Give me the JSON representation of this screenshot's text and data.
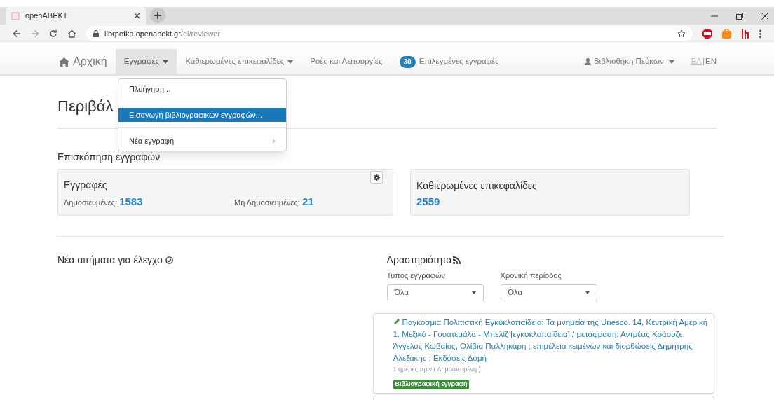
{
  "browser": {
    "tab_title": "openABEKT",
    "url_host": "librpefka.openabekt.gr",
    "url_path": "/el/reviewer"
  },
  "navbar": {
    "items": [
      {
        "kind": "home",
        "label": "Αρχική",
        "selected": false
      },
      {
        "kind": "dropdown",
        "label": "Εγγραφές",
        "selected": true
      },
      {
        "kind": "dropdown",
        "label": "Καθιερωμένες επικεφαλίδες",
        "selected": false
      },
      {
        "kind": "link",
        "label": "Ροές και Λειτουργίες",
        "selected": false
      },
      {
        "kind": "badge",
        "label": "Επιλεγμένες εγγραφές",
        "badge": "30",
        "selected": false
      }
    ],
    "user": "Βιβλιοθήκη Πεύκων",
    "languages": [
      {
        "label": "ΕΛ",
        "selected": true
      },
      {
        "label": "EN",
        "selected": false
      }
    ],
    "language_separator": "|"
  },
  "dropdown_menu": [
    {
      "label": "Πλοήγηση...",
      "selected": false,
      "submenu": false
    },
    {
      "label": "Εισαγωγή βιβλιογραφικών εγγραφών...",
      "selected": true,
      "submenu": false
    },
    {
      "label": "Νέα εγγραφή",
      "selected": false,
      "submenu": true
    }
  ],
  "page_title": "Περιβάλ",
  "overview": {
    "title": "Επισκόπηση εγγραφών",
    "records": {
      "title": "Εγγραφές",
      "published_label": "Δημοσιευμένες:",
      "published": "1583",
      "unpublished_label": "Μη Δημοσιευμένες:",
      "unpublished": "21"
    },
    "headings": {
      "title": "Καθιερωμένες επικεφαλίδες",
      "count": "2559"
    }
  },
  "requests": {
    "title": "Νέα αιτήματα για έλεγχο"
  },
  "activity": {
    "title": "Δραστηριότητα",
    "filters": [
      {
        "label": "Τύπος εγγραφών",
        "value": "Όλα"
      },
      {
        "label": "Χρονική περίοδος",
        "value": "Όλα"
      }
    ],
    "entries": [
      {
        "title": "Παγκόσμια Πολιτιστική Εγκυκλοπαίδεια: Τα μνημεία της Unesco. 14, Κεντρική Αμερική 1. Μεξικό - Γουατεμάλα - Μπελίζ [εγκυκλοπαίδεια] / μετάφραση: Αντρέας Κράουζε, Άγγελος Κωβαίος, Ολίβια Παλληκάρη ; επιμέλεια κειμένων και διορθώσεις Δημήτρης Αλεξάκης ; Εκδόσεις Δομή",
        "meta": "1 ημέρες πριν ( Δημοσιευμένη )",
        "tag": "Βιβλιογραφική εγγραφή"
      }
    ]
  }
}
